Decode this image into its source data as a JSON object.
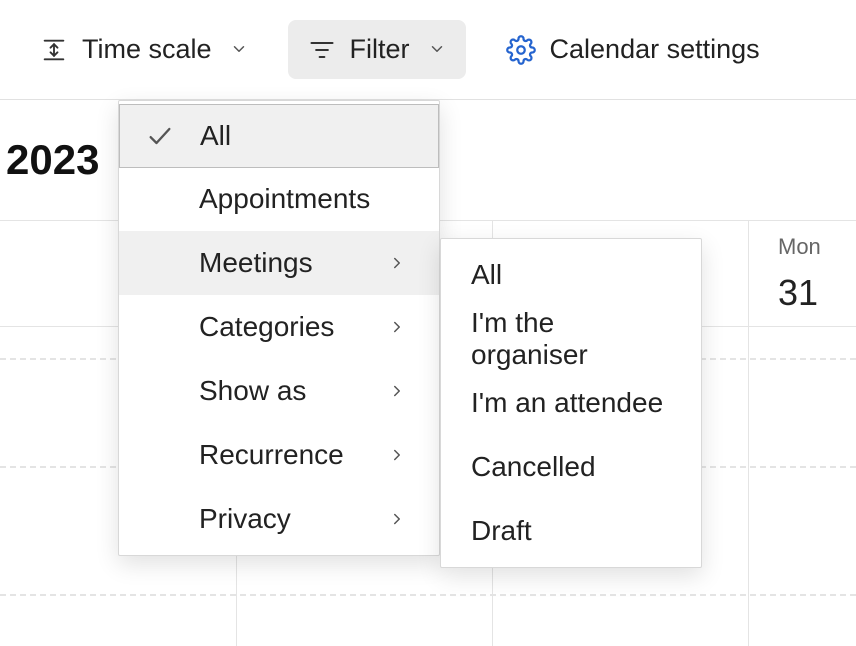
{
  "toolbar": {
    "time_scale": {
      "label": "Time scale"
    },
    "filter": {
      "label": "Filter"
    },
    "settings": {
      "label": "Calendar settings"
    }
  },
  "header": {
    "year": "2023"
  },
  "day_column": {
    "weekday": "Mon",
    "day": "31"
  },
  "filter_menu": {
    "items": [
      {
        "label": "All",
        "checked": true,
        "has_submenu": false
      },
      {
        "label": "Appointments",
        "checked": false,
        "has_submenu": false
      },
      {
        "label": "Meetings",
        "checked": false,
        "has_submenu": true,
        "hovered": true
      },
      {
        "label": "Categories",
        "checked": false,
        "has_submenu": true
      },
      {
        "label": "Show as",
        "checked": false,
        "has_submenu": true
      },
      {
        "label": "Recurrence",
        "checked": false,
        "has_submenu": true
      },
      {
        "label": "Privacy",
        "checked": false,
        "has_submenu": true
      }
    ]
  },
  "meetings_submenu": {
    "items": [
      {
        "label": "All"
      },
      {
        "label": "I'm the organiser"
      },
      {
        "label": "I'm an attendee"
      },
      {
        "label": "Cancelled"
      },
      {
        "label": "Draft"
      }
    ]
  }
}
